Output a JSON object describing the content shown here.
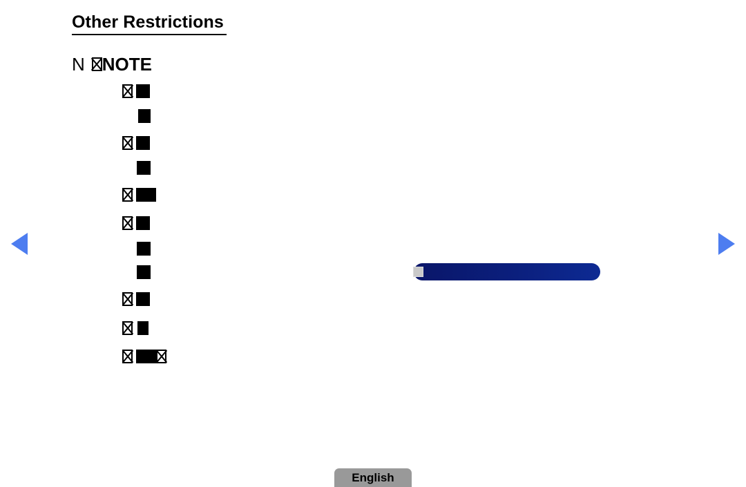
{
  "page": {
    "title": "Other Restrictions",
    "background_color": "#ffffff"
  },
  "note_section": {
    "marker": "N",
    "label": "NOTE",
    "tofu_glyph": "missing-glyph-box"
  },
  "body_lines": [
    {
      "indent": 177,
      "leading_tofu": true,
      "blocks": [
        {
          "width": 20,
          "nick": false
        }
      ]
    },
    {
      "indent": 198,
      "leading_tofu": false,
      "blocks": [
        {
          "width": 20,
          "nick": true
        }
      ]
    },
    {
      "indent": 177,
      "leading_tofu": true,
      "blocks": [
        {
          "width": 20,
          "nick": false
        }
      ]
    },
    {
      "indent": 198,
      "leading_tofu": false,
      "blocks": [
        {
          "width": 20,
          "nick": false
        }
      ]
    },
    {
      "indent": 177,
      "leading_tofu": true,
      "blocks": [
        {
          "width": 29,
          "nick": false
        }
      ]
    },
    {
      "indent": 177,
      "leading_tofu": true,
      "blocks": [
        {
          "width": 20,
          "nick": false
        }
      ]
    },
    {
      "indent": 198,
      "leading_tofu": false,
      "blocks": [
        {
          "width": 20,
          "nick": false
        }
      ]
    },
    {
      "indent": 198,
      "leading_tofu": false,
      "blocks": [
        {
          "width": 20,
          "nick": false
        }
      ]
    },
    {
      "indent": 177,
      "leading_tofu": true,
      "blocks": [
        {
          "width": 20,
          "nick": false
        }
      ]
    },
    {
      "indent": 177,
      "leading_tofu": true,
      "blocks": [
        {
          "width": 18,
          "nick": true
        }
      ]
    },
    {
      "indent": 177,
      "leading_tofu": true,
      "blocks": [
        {
          "width": 29,
          "nick": false
        }
      ],
      "trailing_tofu": true
    }
  ],
  "body_line_tops": [
    122,
    158,
    197,
    233,
    272,
    313,
    350,
    384,
    423,
    465,
    506
  ],
  "highlight": {
    "name": "scroll-highlight-bar",
    "gradient_from": "#0a1669",
    "gradient_to": "#0d2a93",
    "handle_color": "#c9c9c9"
  },
  "navigation": {
    "prev_label": "previous-page",
    "next_label": "next-page",
    "arrow_color": "#4d7df0"
  },
  "language_button": {
    "label": "English",
    "background_color": "#999999"
  }
}
